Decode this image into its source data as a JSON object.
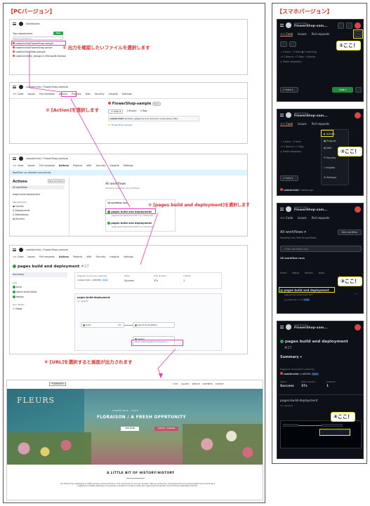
{
  "pc": {
    "header": "【PCバージョン】",
    "s1": {
      "owner": "Dashboard",
      "top_repos": "Top repositories",
      "new_btn": "New",
      "find_placeholder": "Find a repository...",
      "repos": [
        "codeArchist/FlowerShop-sample",
        "codeArchist/FlowerShop-server",
        "codeArchist/Note-sample",
        "codeArchist/ui_design-in-Microsoft-Fashion"
      ]
    },
    "step1": "① 出力を確認したいファイルを選択します",
    "s2": {
      "path": "codeArchist / FlowerShop-sample",
      "tabs": [
        "<> Code",
        "Issues",
        "Pull requests",
        "Actions",
        "Projects",
        "Wiki",
        "Security",
        "Insights",
        "Settings"
      ],
      "repo_title": "FlowerShop-sample",
      "public": "Public",
      "branch": "main",
      "branch_count": "1 Branch",
      "tags": "0 Tags",
      "commit_user": "codeArchist",
      "commit_msg": "Updated .gitignore and removed unnecessary files",
      "file1": "FlowerShop-sample"
    },
    "step2": "② [Action]を選択します",
    "s3": {
      "path": "codeArchist / FlowerShop-sample",
      "tabs": [
        "<> Code",
        "Issues",
        "Pull requests",
        "Actions",
        "Projects",
        "Wiki",
        "Security",
        "Insights",
        "Settings"
      ],
      "flash": "Workflow run deleted successfully.",
      "actions_title": "Actions",
      "new_workflow": "New workflow",
      "all_workflows_item": "All workflows",
      "pages_item": "pages-build-deployment",
      "management": "Management",
      "mgmt_items": [
        "Caches",
        "Deployments",
        "Attestations",
        "Runners"
      ],
      "list_title": "All workflows",
      "list_sub": "Showing runs from all workflows",
      "runs_count": "19 workflow runs",
      "run1": "pages build and deployment",
      "run1_sub": "pages-build-deployment #27: by codeArchist",
      "run2": "pages build and deployment",
      "run2_sub": "pages-build-deployment #26: by codeArchist"
    },
    "step3": "③ [pages build and deployment]を選択します",
    "s4": {
      "path": "codeArchist / FlowerShop-sample",
      "tabs": [
        "<> Code",
        "Issues",
        "Pull requests",
        "Actions",
        "Projects",
        "Wiki",
        "Security",
        "Insights",
        "Settings"
      ],
      "title": "pages build and deployment",
      "run_no": "#27",
      "summary": "Summary",
      "jobs_label": "Jobs",
      "jobs": [
        "build",
        "report-build-status",
        "deploy"
      ],
      "run_details": "Run details",
      "usage": "Usage",
      "triggered": "Triggered via dynamic yesterday",
      "actor": "codeArchist",
      "commit": "-o d65380",
      "branch_tag": "main",
      "status_label": "Status",
      "status_val": "Success",
      "duration_label": "Total duration",
      "duration_val": "37s",
      "artifacts_label": "Artifacts",
      "artifacts_val": "1",
      "wf_name": "pages-build-deployment",
      "wf_sub": "on: dynamic",
      "node_build": "build",
      "node_build_time": "16s",
      "node_report": "report-build-status",
      "node_deploy": "deploy",
      "url": "https://codeArchist.github.io/FlowerShop-s..."
    },
    "step4": "④ [URL]を選択すると画面が出力されます",
    "site": {
      "logo_btn": "FLOWERSHOP",
      "nav": [
        "HOME",
        "GALLERY",
        "SERVICE",
        "CONTENTS",
        "CONTACT"
      ],
      "shop_sign": "FLEURS",
      "kicker": "FLOWER SHOP · TOKYO",
      "hero": "FLORAISON / A FRESH OPPRTUNITY",
      "cta1": "VIEW MORE",
      "cta2": "CONTACT · BOOKING",
      "history_title": "A LITTLE BIT OF HISTORY/HISTORY",
      "history_text": "Our flower shop, established in 1998, has been a beloved fixture in the community for over two decades, offering a wide array of exquisite blooms and personalized services that have brightened countless weddings, anniversaries, and special occasions, while also supporting local growers and promoting sustainable practices."
    }
  },
  "mobile": {
    "header": "【スマホバージョン】",
    "m1": {
      "repo_owner": "codeArchist /",
      "repo_name": "FlowerShop-sam...",
      "tabs": [
        "<> Code",
        "Issues",
        "Pull requests"
      ],
      "stars": "0 stars",
      "forks": "0 forks",
      "watching": "1 watching",
      "branch": "1 Branch",
      "tags": "0 Tags",
      "activity": "Activity",
      "public_repo": "Public repository",
      "branch_btn": "main",
      "code_btn": "Code",
      "bubble": "①ここ！"
    },
    "m2": {
      "repo_owner": "codeArchist /",
      "repo_name": "FlowerShop-sam...",
      "tabs": [
        "<> Code",
        "Issues",
        "Pull requests"
      ],
      "menu": [
        "Actions",
        "Projects",
        "Wiki",
        "Security",
        "Insights",
        "Settings"
      ],
      "stars": "0 stars",
      "forks": "0 forks",
      "branch": "1 Branch",
      "tags": "0 Tags",
      "public_repo": "Public repository",
      "branch_btn": "main",
      "commit_user": "codeArchist",
      "commit_time": "3 weeks ago",
      "bubble": "②ここ！"
    },
    "m3": {
      "repo_owner": "codeArchist /",
      "repo_name": "FlowerShop-sam...",
      "tabs": [
        "<> Code",
        "Issues",
        "Pull requests"
      ],
      "all_workflows": "All workflows",
      "new_workflow": "New workflow",
      "showing": "Showing runs from all workflows",
      "filter_placeholder": "Filter workflow runs",
      "runs": "26 workflow runs",
      "cols": [
        "Event",
        "Status",
        "Branch",
        "Actor"
      ],
      "run": "pages build and deployment",
      "run_sub": "pages-build-deployment #27",
      "run_time": "yesterday",
      "run_dur": "37s",
      "run_tag": "main",
      "bubble": "③ここ！"
    },
    "m4": {
      "repo_owner": "codeArchist /",
      "repo_name": "FlowerShop-sam...",
      "title": "pages build and deployment",
      "run_no": "#27",
      "summary": "Summary",
      "triggered": "Triggered via dynamic yesterday",
      "actor": "codeArchist",
      "commit": "-o d65380",
      "tag": "main",
      "status_label": "Status",
      "duration_label": "Total duration",
      "artifacts_label": "Artifacts",
      "status_val": "Success",
      "duration_val": "37s",
      "artifacts_val": "1",
      "wf_name": "pages-build-deployment",
      "wf_sub": "on: dynamic",
      "bubble": "④ここ！"
    }
  }
}
